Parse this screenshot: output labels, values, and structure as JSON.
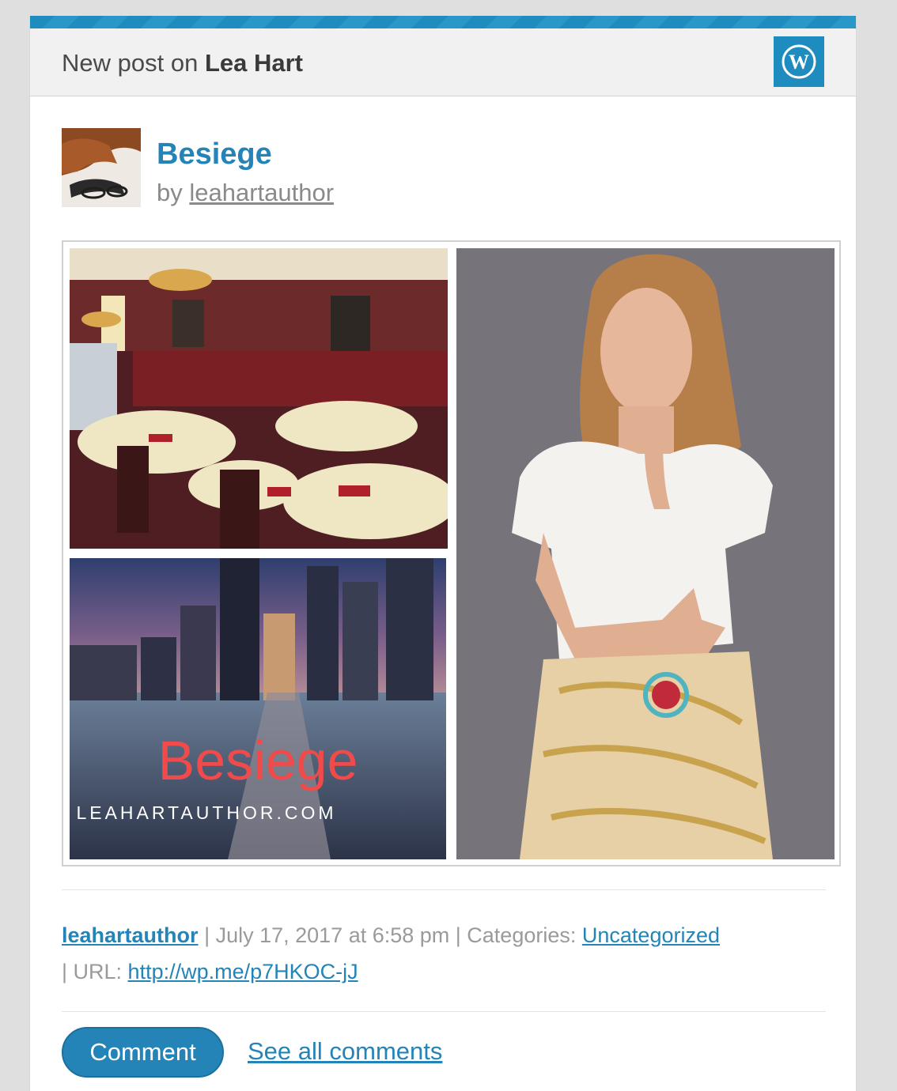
{
  "header": {
    "prefix": "New post on",
    "site_name": "Lea Hart",
    "logo_icon": "wordpress-logo-icon"
  },
  "post": {
    "title": "Besiege",
    "by_label": "by",
    "author": "leahartauthor"
  },
  "image": {
    "title_overlay": "Besiege",
    "site_overlay": "LEAHARTAUTHOR.COM"
  },
  "meta": {
    "author": "leahartauthor",
    "date_text": "| July 17, 2017 at 6:58 pm | Categories:",
    "category": "Uncategorized",
    "url_label": "| URL:",
    "url": "http://wp.me/p7HKOC-jJ"
  },
  "actions": {
    "comment_label": "Comment",
    "see_all_label": "See all comments"
  },
  "colors": {
    "accent": "#2484b8",
    "header_bg": "#f1f1f1",
    "meta_text": "#9a9a9a"
  }
}
